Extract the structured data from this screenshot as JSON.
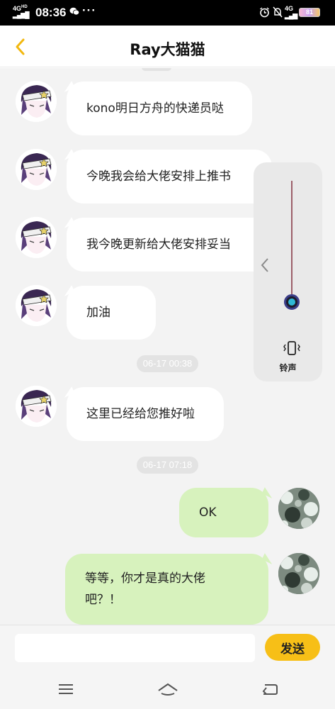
{
  "status_bar": {
    "network": "4G",
    "network_sub": "HD",
    "time": "08:36",
    "more": "···",
    "network_right": "4G",
    "battery": "81"
  },
  "header": {
    "title": "Ray大猫猫"
  },
  "messages": [
    {
      "sender": "other",
      "text": "kono明日方舟的快递员哒"
    },
    {
      "sender": "other",
      "text": "今晚我会给大佬安排上推书"
    },
    {
      "sender": "other",
      "text": "我今晚更新给大佬安排妥当"
    },
    {
      "sender": "other",
      "text": "加油"
    },
    {
      "sender": "other",
      "text": "这里已经给您推好啦"
    },
    {
      "sender": "me",
      "text": "OK"
    },
    {
      "sender": "me",
      "text_line1": "等等，你才是真的大佬",
      "text_line2": "吧？！"
    }
  ],
  "timestamps": [
    "06-17 00:38",
    "06-17 07:18"
  ],
  "volume_panel": {
    "mode_label": "铃声",
    "level": 0.05
  },
  "input_bar": {
    "value": "",
    "send_label": "发送"
  },
  "colors": {
    "accent": "#f7bf17",
    "incoming_bubble": "#ffffff",
    "outgoing_bubble": "#d7f2bd",
    "chat_background": "#f3f3f3"
  }
}
